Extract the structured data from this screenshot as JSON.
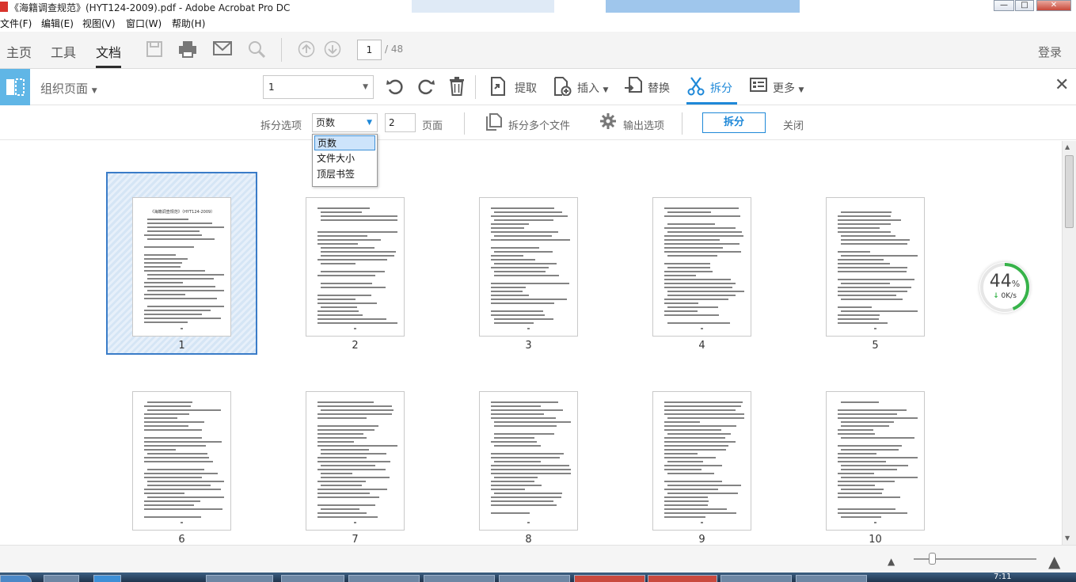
{
  "window": {
    "title": "《海籍调查规范》(HYT124-2009).pdf - Adobe Acrobat Pro DC",
    "controls": {
      "minimize": "—",
      "restore": "□",
      "close": "✕"
    }
  },
  "menubar": [
    {
      "id": "file",
      "label": "文件(F)"
    },
    {
      "id": "edit",
      "label": "编辑(E)"
    },
    {
      "id": "view",
      "label": "视图(V)"
    },
    {
      "id": "window",
      "label": "窗口(W)"
    },
    {
      "id": "help",
      "label": "帮助(H)"
    }
  ],
  "toptabs": [
    {
      "id": "home",
      "label": "主页"
    },
    {
      "id": "tools",
      "label": "工具"
    },
    {
      "id": "document",
      "label": "文档",
      "active": true
    }
  ],
  "toptoolbar": {
    "icons": [
      "save-icon",
      "print-icon",
      "email-icon",
      "search-icon",
      "page-up-icon",
      "page-down-icon"
    ],
    "current_page": "1",
    "total_pages": "/ 48",
    "login": "登录"
  },
  "organize": {
    "title": "组织页面",
    "page_selector": "1",
    "actions": {
      "extract": "提取",
      "insert": "插入",
      "replace": "替换",
      "split": "拆分",
      "more": "更多"
    }
  },
  "splitbar": {
    "options_label": "拆分选项",
    "option_selected": "页数",
    "pages_value": "2",
    "pages_unit": "页面",
    "split_multiple": "拆分多个文件",
    "output_options": "输出选项",
    "split_button": "拆分",
    "close_button": "关闭"
  },
  "split_dropdown": {
    "options": [
      "页数",
      "文件大小",
      "顶层书签"
    ],
    "selected_index": 0
  },
  "thumbnails": [
    {
      "page": "1",
      "selected": true
    },
    {
      "page": "2"
    },
    {
      "page": "3"
    },
    {
      "page": "4"
    },
    {
      "page": "5"
    },
    {
      "page": "6"
    },
    {
      "page": "7"
    },
    {
      "page": "8"
    },
    {
      "page": "9"
    },
    {
      "page": "10"
    }
  ],
  "first_page_heading": "《海籍调查规范》（HYT124-2009）",
  "progress": {
    "percent": 44,
    "percent_label": "44",
    "percent_sign": "%",
    "speed": "0K/s",
    "color": "#37b34a"
  },
  "statusbar": {
    "zoom_level": 0.15
  },
  "taskbar": {
    "clock": "7:11"
  },
  "colors": {
    "accent": "#1e88d8",
    "selection": "#3a7cc8",
    "organize_icon_bg": "#60b6e6"
  }
}
